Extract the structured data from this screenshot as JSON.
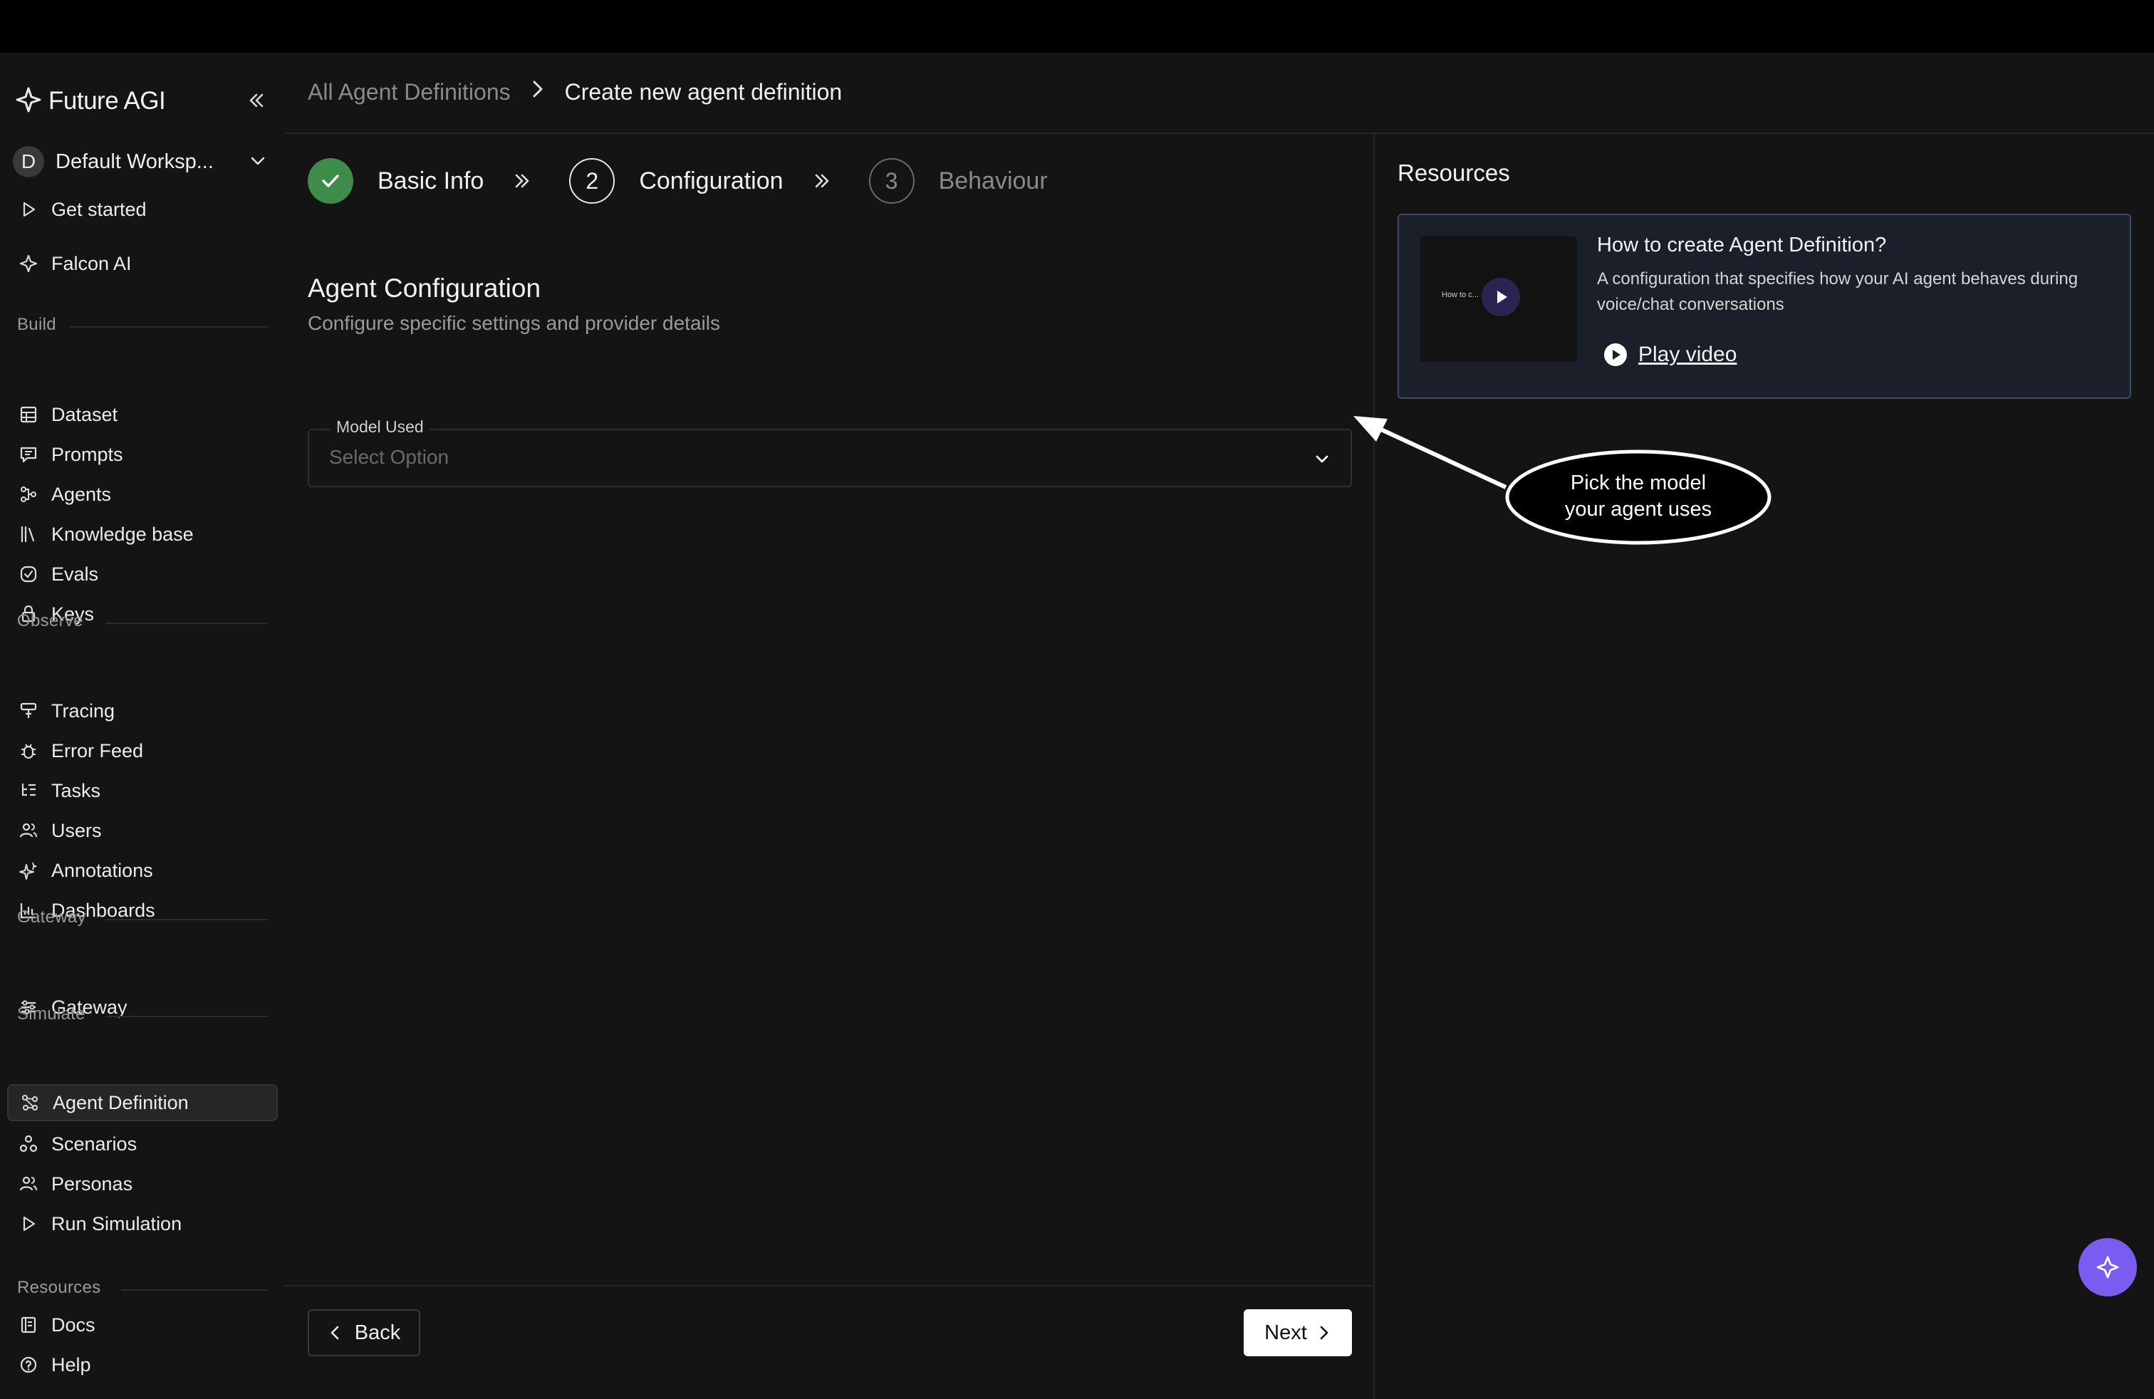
{
  "brand": {
    "name": "Future AGI"
  },
  "workspace": {
    "initial": "D",
    "name": "Default Worksp..."
  },
  "sidebar": {
    "top_items": [
      {
        "label": "Get started",
        "icon": "play-outline-icon"
      },
      {
        "label": "Falcon AI",
        "icon": "falcon-icon"
      }
    ],
    "sections": [
      {
        "label": "Build",
        "items": [
          {
            "label": "Dataset",
            "icon": "table-icon"
          },
          {
            "label": "Prompts",
            "icon": "chat-icon"
          },
          {
            "label": "Agents",
            "icon": "agents-icon"
          },
          {
            "label": "Knowledge base",
            "icon": "library-icon"
          },
          {
            "label": "Evals",
            "icon": "check-circle-icon"
          },
          {
            "label": "Keys",
            "icon": "lock-icon"
          }
        ]
      },
      {
        "label": "Observe",
        "items": [
          {
            "label": "Tracing",
            "icon": "tracing-icon"
          },
          {
            "label": "Error Feed",
            "icon": "bug-icon"
          },
          {
            "label": "Tasks",
            "icon": "tasks-icon"
          },
          {
            "label": "Users",
            "icon": "users-icon"
          },
          {
            "label": "Annotations",
            "icon": "sparkle-icon"
          },
          {
            "label": "Dashboards",
            "icon": "bar-chart-icon"
          }
        ]
      },
      {
        "label": "Gateway",
        "items": [
          {
            "label": "Gateway",
            "icon": "gateway-icon"
          }
        ]
      },
      {
        "label": "Simulate",
        "items": [
          {
            "label": "Agent Definition",
            "icon": "nodes-icon",
            "active": true
          },
          {
            "label": "Scenarios",
            "icon": "scenarios-icon"
          },
          {
            "label": "Personas",
            "icon": "users-icon"
          },
          {
            "label": "Run Simulation",
            "icon": "play-outline-icon"
          }
        ]
      },
      {
        "label": "Resources",
        "items": [
          {
            "label": "Docs",
            "icon": "docs-icon"
          },
          {
            "label": "Help",
            "icon": "help-icon"
          }
        ]
      }
    ]
  },
  "breadcrumb": {
    "parent": "All Agent Definitions",
    "current": "Create new agent definition"
  },
  "steps": [
    {
      "number": "1",
      "label": "Basic Info",
      "state": "done"
    },
    {
      "number": "2",
      "label": "Configuration",
      "state": "current"
    },
    {
      "number": "3",
      "label": "Behaviour",
      "state": "todo"
    }
  ],
  "form": {
    "title": "Agent Configuration",
    "subtitle": "Configure specific settings and provider details",
    "model_field": {
      "label": "Model Used",
      "placeholder": "Select Option"
    }
  },
  "footer": {
    "back_label": "Back",
    "next_label": "Next"
  },
  "resources": {
    "title": "Resources",
    "card": {
      "thumbnail_text": "How to c... ...ic Data ?",
      "title": "How to create Agent Definition?",
      "description": "A configuration that specifies how your AI agent behaves during voice/chat conversations",
      "link_label": "Play video"
    }
  },
  "annotation": {
    "line1": "Pick the model",
    "line2": "your agent uses"
  },
  "colors": {
    "accent": "#7b5cf0",
    "success": "#3f8c4a",
    "card_border": "#3c4a63"
  }
}
